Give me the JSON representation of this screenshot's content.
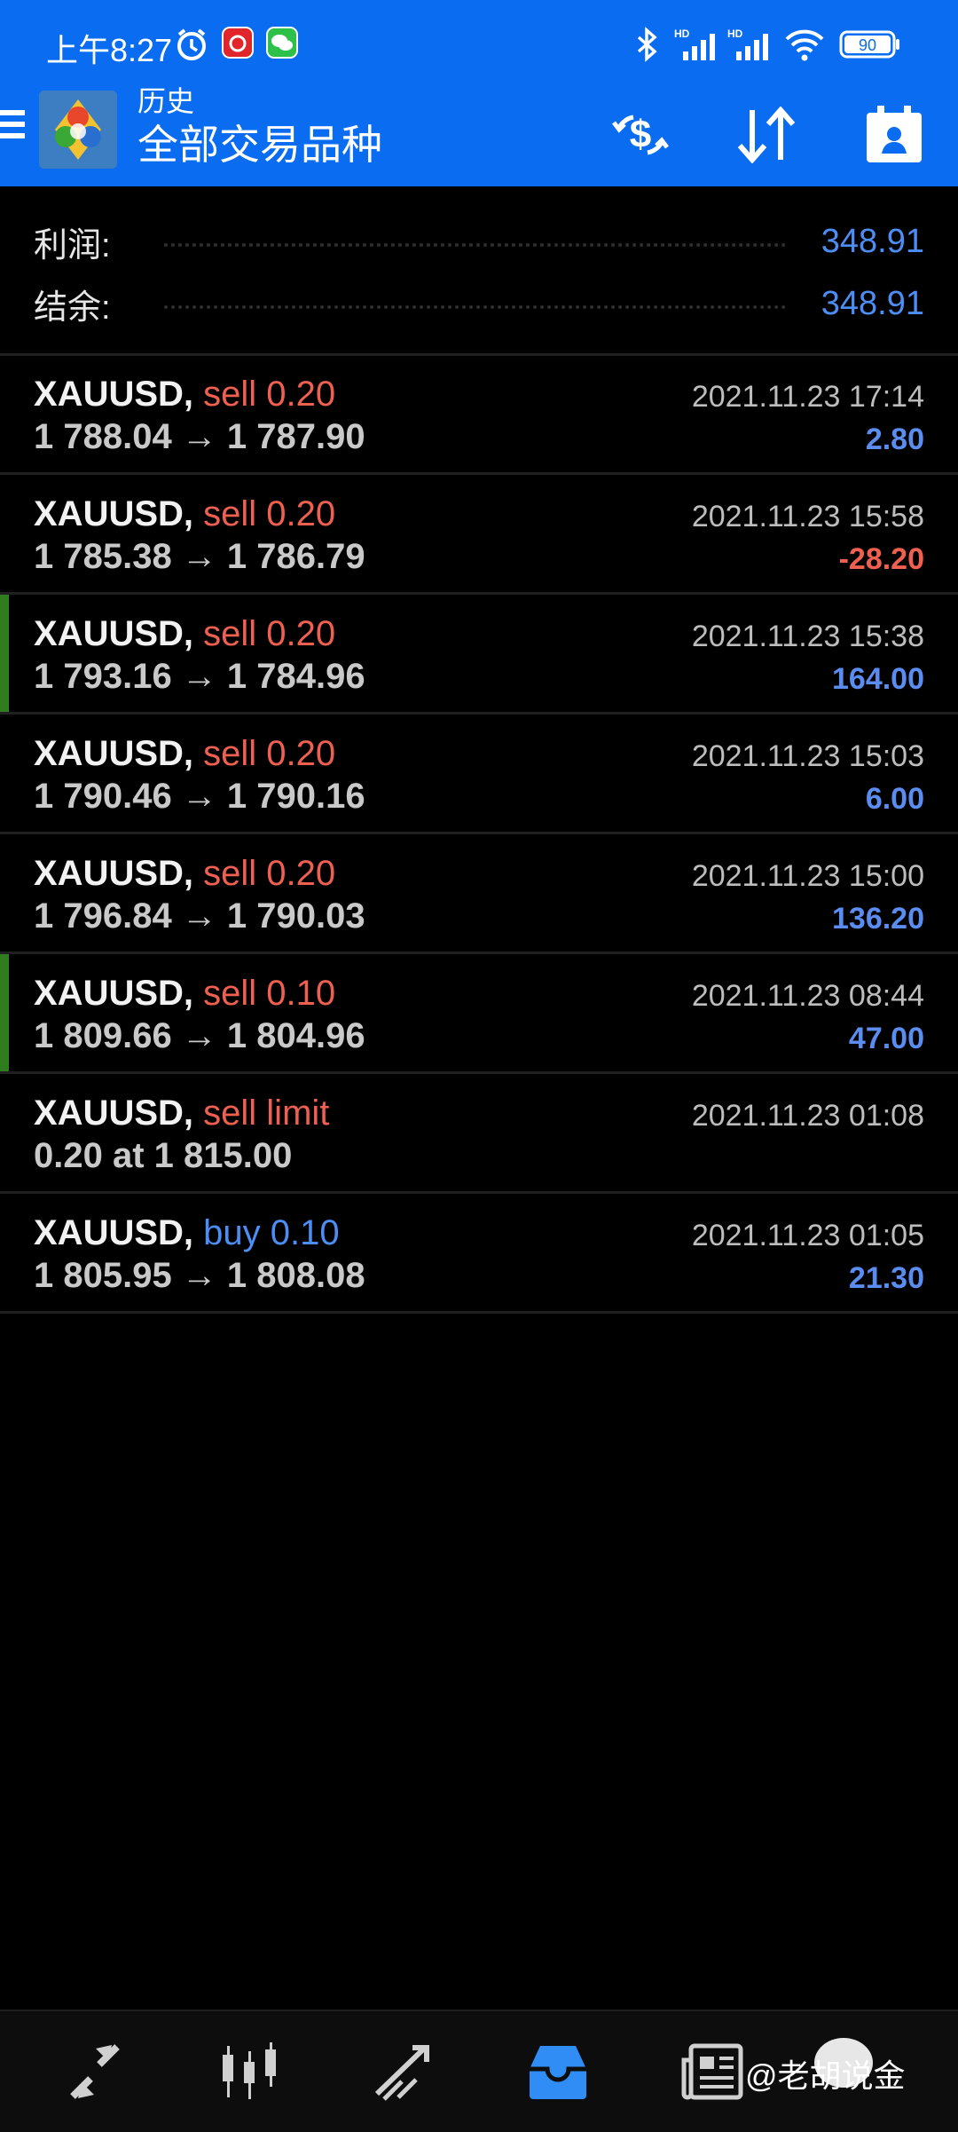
{
  "status_bar": {
    "time": "上午8:27",
    "battery": "90",
    "icons": [
      "alarm-icon",
      "netease-music-icon",
      "wechat-icon",
      "bluetooth-icon",
      "hd-signal-icon",
      "hd-signal-icon",
      "wifi-icon",
      "battery-icon"
    ]
  },
  "header": {
    "subtitle": "历史",
    "title": "全部交易品种",
    "buttons": [
      "deposit-currency-icon",
      "sort-icon",
      "calendar-icon"
    ]
  },
  "summary": {
    "profit_label": "利润:",
    "profit_value": "348.91",
    "balance_label": "结余:",
    "balance_value": "348.91"
  },
  "deals": [
    {
      "symbol": "XAUUSD,",
      "type": "sell 0.20",
      "side": "sell",
      "prices": "1 788.04 → 1 787.90",
      "time": "2021.11.23 17:14",
      "profit": "2.80",
      "marked": false
    },
    {
      "symbol": "XAUUSD,",
      "type": "sell 0.20",
      "side": "sell",
      "prices": "1 785.38 → 1 786.79",
      "time": "2021.11.23 15:58",
      "profit": "-28.20",
      "marked": false
    },
    {
      "symbol": "XAUUSD,",
      "type": "sell 0.20",
      "side": "sell",
      "prices": "1 793.16 → 1 784.96",
      "time": "2021.11.23 15:38",
      "profit": "164.00",
      "marked": true
    },
    {
      "symbol": "XAUUSD,",
      "type": "sell 0.20",
      "side": "sell",
      "prices": "1 790.46 → 1 790.16",
      "time": "2021.11.23 15:03",
      "profit": "6.00",
      "marked": false
    },
    {
      "symbol": "XAUUSD,",
      "type": "sell 0.20",
      "side": "sell",
      "prices": "1 796.84 → 1 790.03",
      "time": "2021.11.23 15:00",
      "profit": "136.20",
      "marked": false
    },
    {
      "symbol": "XAUUSD,",
      "type": "sell 0.10",
      "side": "sell",
      "prices": "1 809.66 → 1 804.96",
      "time": "2021.11.23 08:44",
      "profit": "47.00",
      "marked": true
    },
    {
      "symbol": "XAUUSD,",
      "type": "sell limit",
      "side": "sell",
      "prices": "0.20 at 1 815.00",
      "time": "2021.11.23 01:08",
      "profit": "",
      "marked": false
    },
    {
      "symbol": "XAUUSD,",
      "type": "buy 0.10",
      "side": "buy",
      "prices": "1 805.95 → 1 808.08",
      "time": "2021.11.23 01:05",
      "profit": "21.30",
      "marked": false
    }
  ],
  "bottom_nav": {
    "items": [
      "quotes-icon",
      "chart-icon",
      "trade-icon",
      "history-icon",
      "news-icon"
    ],
    "active": "history-icon"
  },
  "watermark": "@老胡说金",
  "colors": {
    "header_bg": "#0a6cf0",
    "positive": "#5b8df0",
    "negative": "#f06050",
    "sell": "#f06050",
    "buy": "#4d8ef5"
  }
}
